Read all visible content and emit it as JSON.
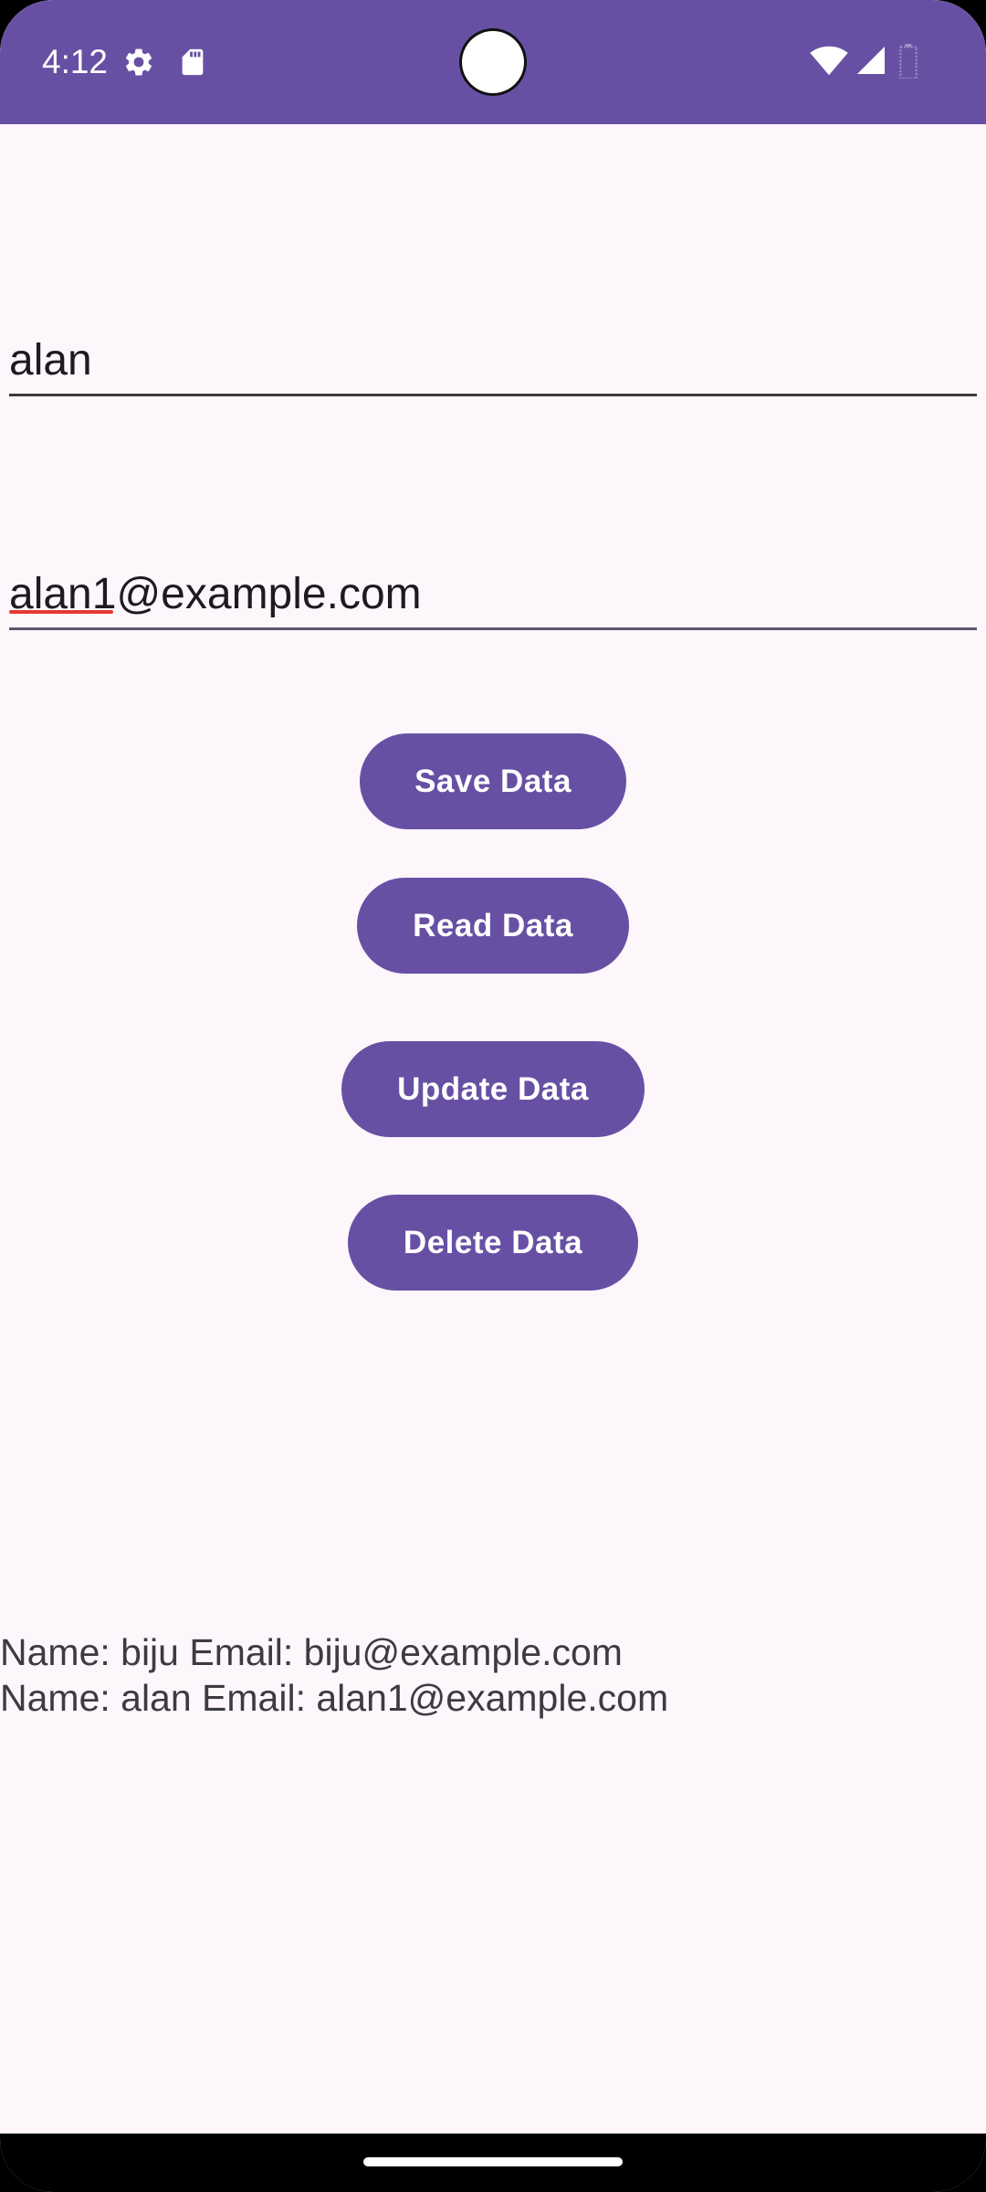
{
  "status_bar": {
    "time": "4:12",
    "icons_left": [
      "gear-icon",
      "sd-card-icon"
    ],
    "icons_right": [
      "wifi-icon",
      "signal-icon",
      "battery-icon"
    ],
    "color": "#6750a4"
  },
  "form": {
    "name_value": "alan",
    "email_value": "alan1@example.com"
  },
  "buttons": {
    "save": "Save Data",
    "read": "Read Data",
    "update": "Update Data",
    "delete": "Delete Data"
  },
  "output": {
    "lines": [
      "Name: biju Email: biju@example.com",
      "Name: alan Email: alan1@example.com"
    ]
  },
  "colors": {
    "accent": "#6750a4",
    "background": "#fdf7fc",
    "text": "#1d1b20"
  }
}
